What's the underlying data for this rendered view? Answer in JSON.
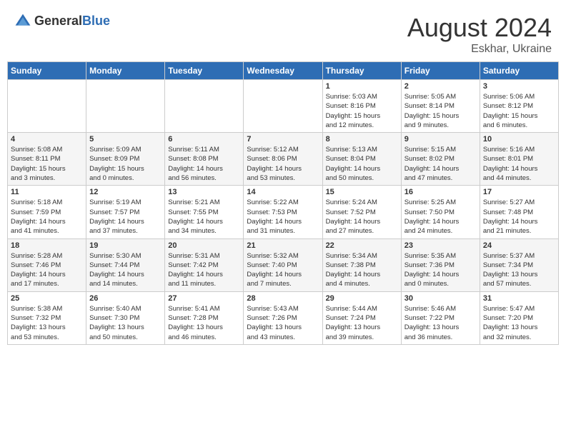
{
  "header": {
    "logo_general": "General",
    "logo_blue": "Blue",
    "month_year": "August 2024",
    "location": "Eskhar, Ukraine"
  },
  "calendar": {
    "days_of_week": [
      "Sunday",
      "Monday",
      "Tuesday",
      "Wednesday",
      "Thursday",
      "Friday",
      "Saturday"
    ],
    "weeks": [
      [
        {
          "day": "",
          "info": ""
        },
        {
          "day": "",
          "info": ""
        },
        {
          "day": "",
          "info": ""
        },
        {
          "day": "",
          "info": ""
        },
        {
          "day": "1",
          "info": "Sunrise: 5:03 AM\nSunset: 8:16 PM\nDaylight: 15 hours\nand 12 minutes."
        },
        {
          "day": "2",
          "info": "Sunrise: 5:05 AM\nSunset: 8:14 PM\nDaylight: 15 hours\nand 9 minutes."
        },
        {
          "day": "3",
          "info": "Sunrise: 5:06 AM\nSunset: 8:12 PM\nDaylight: 15 hours\nand 6 minutes."
        }
      ],
      [
        {
          "day": "4",
          "info": "Sunrise: 5:08 AM\nSunset: 8:11 PM\nDaylight: 15 hours\nand 3 minutes."
        },
        {
          "day": "5",
          "info": "Sunrise: 5:09 AM\nSunset: 8:09 PM\nDaylight: 15 hours\nand 0 minutes."
        },
        {
          "day": "6",
          "info": "Sunrise: 5:11 AM\nSunset: 8:08 PM\nDaylight: 14 hours\nand 56 minutes."
        },
        {
          "day": "7",
          "info": "Sunrise: 5:12 AM\nSunset: 8:06 PM\nDaylight: 14 hours\nand 53 minutes."
        },
        {
          "day": "8",
          "info": "Sunrise: 5:13 AM\nSunset: 8:04 PM\nDaylight: 14 hours\nand 50 minutes."
        },
        {
          "day": "9",
          "info": "Sunrise: 5:15 AM\nSunset: 8:02 PM\nDaylight: 14 hours\nand 47 minutes."
        },
        {
          "day": "10",
          "info": "Sunrise: 5:16 AM\nSunset: 8:01 PM\nDaylight: 14 hours\nand 44 minutes."
        }
      ],
      [
        {
          "day": "11",
          "info": "Sunrise: 5:18 AM\nSunset: 7:59 PM\nDaylight: 14 hours\nand 41 minutes."
        },
        {
          "day": "12",
          "info": "Sunrise: 5:19 AM\nSunset: 7:57 PM\nDaylight: 14 hours\nand 37 minutes."
        },
        {
          "day": "13",
          "info": "Sunrise: 5:21 AM\nSunset: 7:55 PM\nDaylight: 14 hours\nand 34 minutes."
        },
        {
          "day": "14",
          "info": "Sunrise: 5:22 AM\nSunset: 7:53 PM\nDaylight: 14 hours\nand 31 minutes."
        },
        {
          "day": "15",
          "info": "Sunrise: 5:24 AM\nSunset: 7:52 PM\nDaylight: 14 hours\nand 27 minutes."
        },
        {
          "day": "16",
          "info": "Sunrise: 5:25 AM\nSunset: 7:50 PM\nDaylight: 14 hours\nand 24 minutes."
        },
        {
          "day": "17",
          "info": "Sunrise: 5:27 AM\nSunset: 7:48 PM\nDaylight: 14 hours\nand 21 minutes."
        }
      ],
      [
        {
          "day": "18",
          "info": "Sunrise: 5:28 AM\nSunset: 7:46 PM\nDaylight: 14 hours\nand 17 minutes."
        },
        {
          "day": "19",
          "info": "Sunrise: 5:30 AM\nSunset: 7:44 PM\nDaylight: 14 hours\nand 14 minutes."
        },
        {
          "day": "20",
          "info": "Sunrise: 5:31 AM\nSunset: 7:42 PM\nDaylight: 14 hours\nand 11 minutes."
        },
        {
          "day": "21",
          "info": "Sunrise: 5:32 AM\nSunset: 7:40 PM\nDaylight: 14 hours\nand 7 minutes."
        },
        {
          "day": "22",
          "info": "Sunrise: 5:34 AM\nSunset: 7:38 PM\nDaylight: 14 hours\nand 4 minutes."
        },
        {
          "day": "23",
          "info": "Sunrise: 5:35 AM\nSunset: 7:36 PM\nDaylight: 14 hours\nand 0 minutes."
        },
        {
          "day": "24",
          "info": "Sunrise: 5:37 AM\nSunset: 7:34 PM\nDaylight: 13 hours\nand 57 minutes."
        }
      ],
      [
        {
          "day": "25",
          "info": "Sunrise: 5:38 AM\nSunset: 7:32 PM\nDaylight: 13 hours\nand 53 minutes."
        },
        {
          "day": "26",
          "info": "Sunrise: 5:40 AM\nSunset: 7:30 PM\nDaylight: 13 hours\nand 50 minutes."
        },
        {
          "day": "27",
          "info": "Sunrise: 5:41 AM\nSunset: 7:28 PM\nDaylight: 13 hours\nand 46 minutes."
        },
        {
          "day": "28",
          "info": "Sunrise: 5:43 AM\nSunset: 7:26 PM\nDaylight: 13 hours\nand 43 minutes."
        },
        {
          "day": "29",
          "info": "Sunrise: 5:44 AM\nSunset: 7:24 PM\nDaylight: 13 hours\nand 39 minutes."
        },
        {
          "day": "30",
          "info": "Sunrise: 5:46 AM\nSunset: 7:22 PM\nDaylight: 13 hours\nand 36 minutes."
        },
        {
          "day": "31",
          "info": "Sunrise: 5:47 AM\nSunset: 7:20 PM\nDaylight: 13 hours\nand 32 minutes."
        }
      ]
    ]
  }
}
